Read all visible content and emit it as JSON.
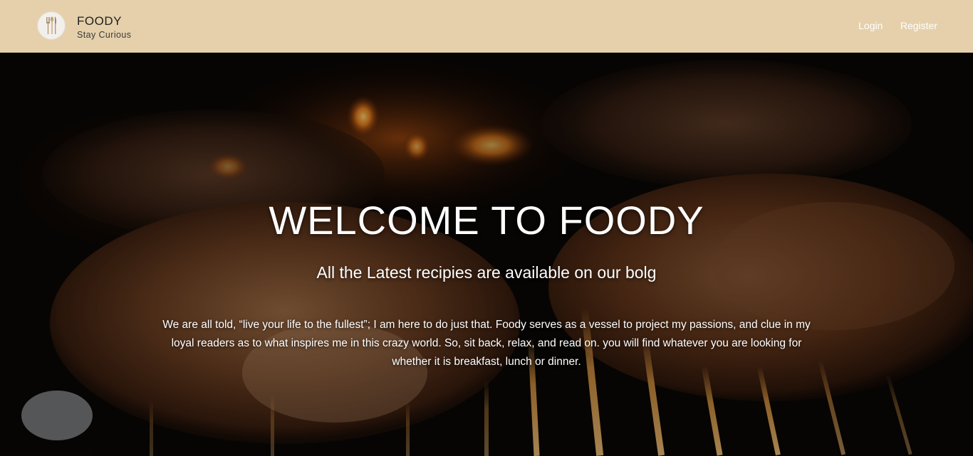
{
  "header": {
    "brand_name": "FOODY",
    "tagline": "Stay Curious",
    "nav": [
      {
        "label": "Login"
      },
      {
        "label": "Register"
      }
    ],
    "logo_icon": "cutlery-icon",
    "background_color": "#e5d0ab"
  },
  "hero": {
    "title": "WELCOME TO FOODY",
    "subtitle": "All the Latest recipies are available on our bolg",
    "description": "We are all told, “live your life to the fullest”; I am here to do just that. Foody serves as a vessel to project my passions, and clue in my loyal readers as to what inspires me in this crazy world. So, sit back, relax, and read on. you will find whatever you are looking for whether it is breakfast, lunch or dinner.",
    "background": "grilled-chicken-photo"
  }
}
